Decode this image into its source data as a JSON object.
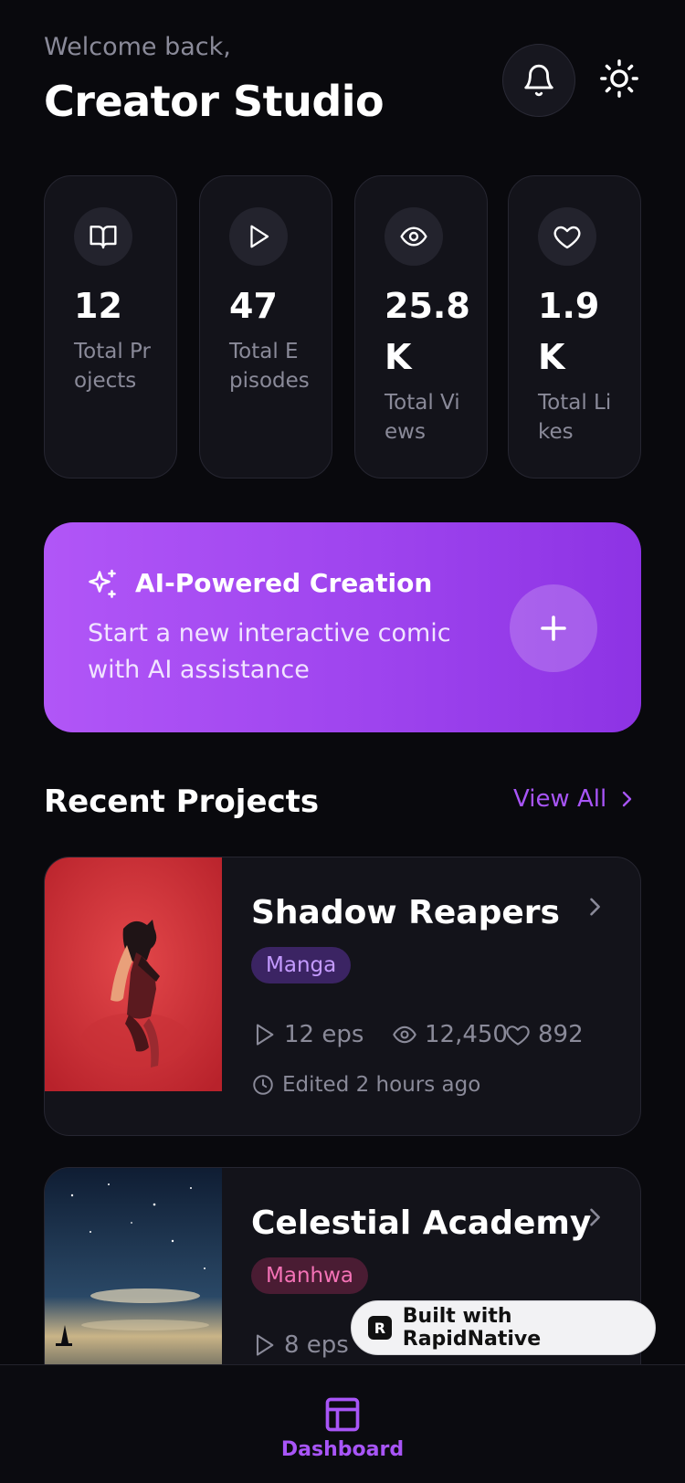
{
  "header": {
    "welcome": "Welcome back,",
    "title": "Creator Studio"
  },
  "stats": [
    {
      "icon": "book-open-icon",
      "value": "12",
      "label": "Total Projects"
    },
    {
      "icon": "play-icon",
      "value": "47",
      "label": "Total Episodes"
    },
    {
      "icon": "eye-icon",
      "value": "25.8K",
      "label": "Total Views"
    },
    {
      "icon": "heart-icon",
      "value": "1.9K",
      "label": "Total Likes"
    }
  ],
  "ai_banner": {
    "title": "AI-Powered Creation",
    "description": "Start a new interactive comic with AI assistance"
  },
  "recent": {
    "title": "Recent Projects",
    "view_all": "View All"
  },
  "projects": [
    {
      "title": "Shadow Reapers",
      "genre": "Manga",
      "episodes": "12 eps",
      "views": "12,450",
      "likes": "892",
      "edited": "Edited 2 hours ago"
    },
    {
      "title": "Celestial Academy",
      "genre": "Manhwa",
      "episodes": "8 eps"
    }
  ],
  "built_with": "Built with RapidNative",
  "nav": {
    "dashboard_label": "Dashboard"
  },
  "colors": {
    "accent": "#a855f7",
    "background": "#09090d",
    "card": "#13131a",
    "manga_badge": "#3b2463",
    "manhwa_badge": "#4a1c33"
  }
}
